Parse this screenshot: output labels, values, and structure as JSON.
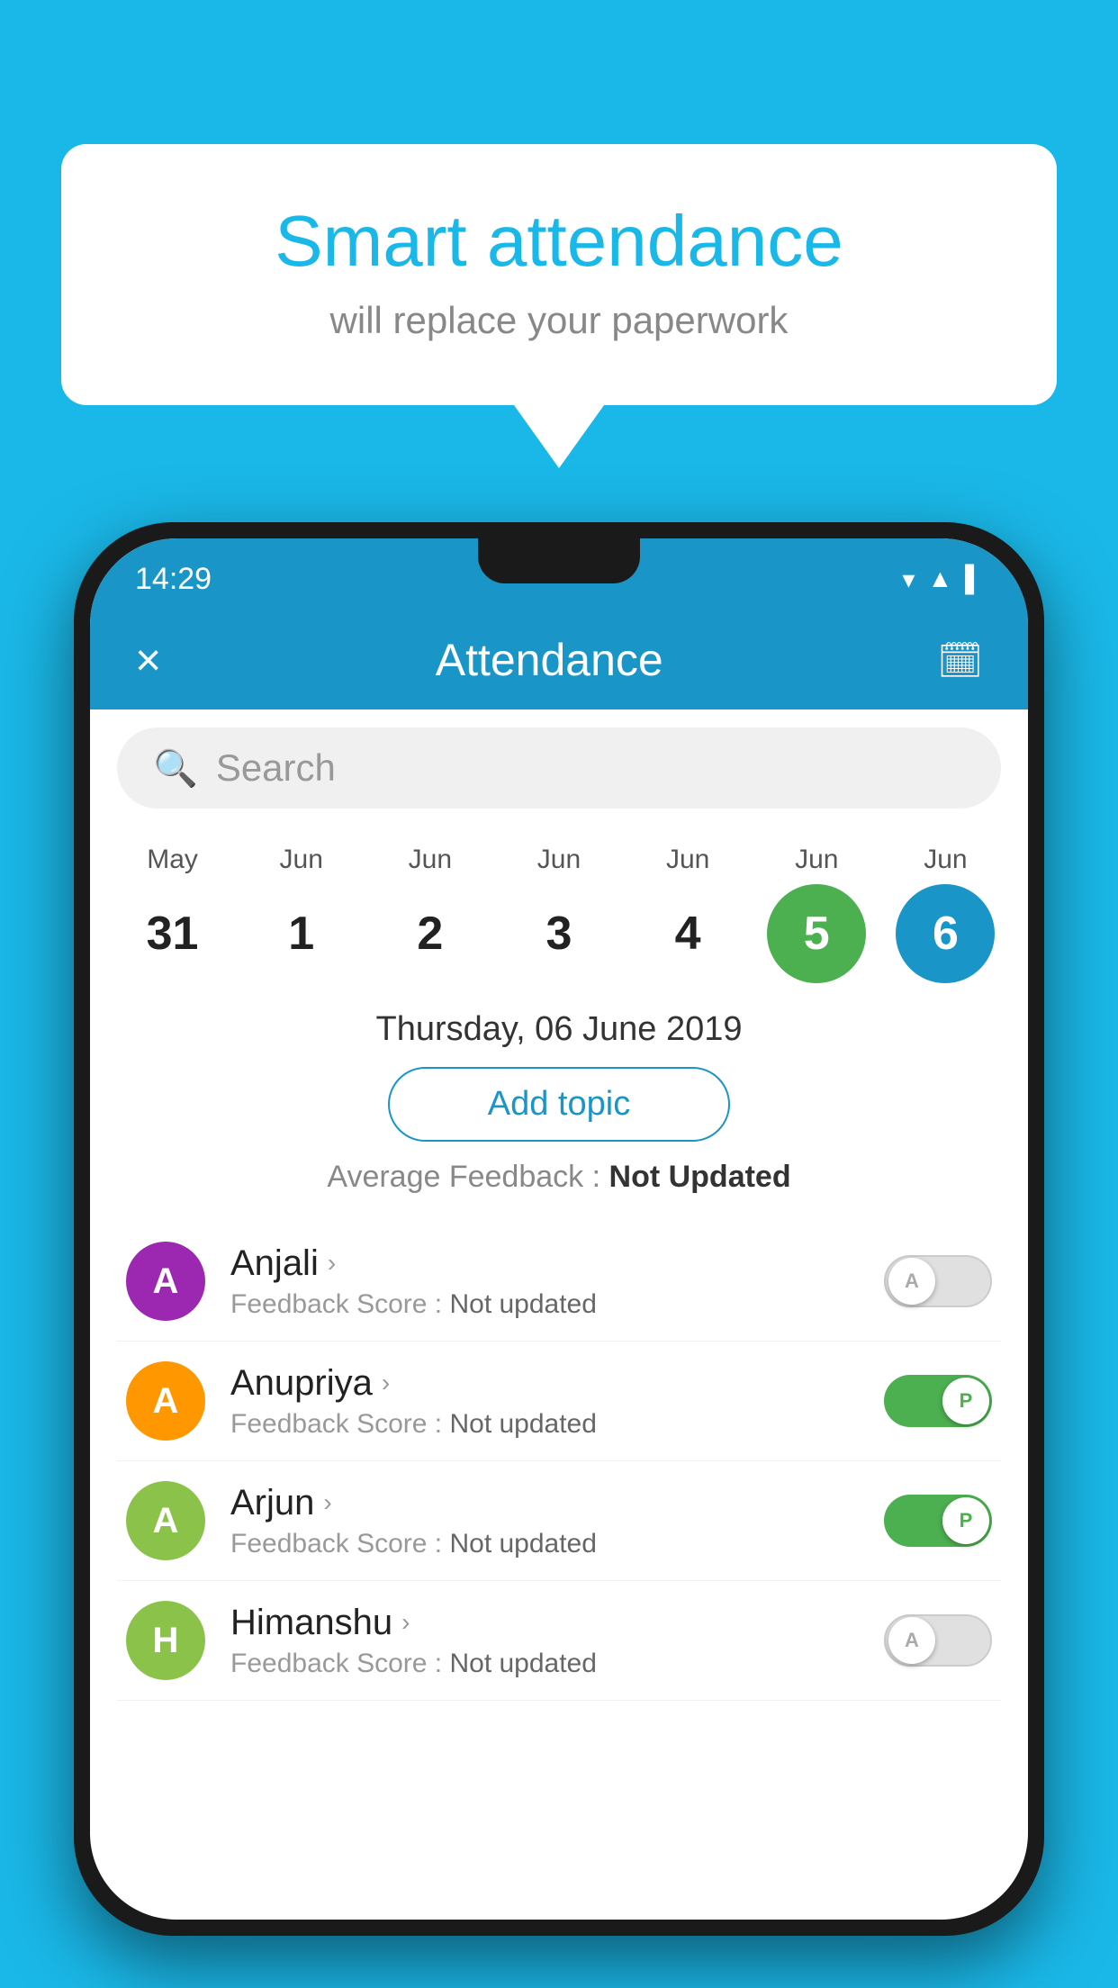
{
  "background_color": "#1ab8e8",
  "speech_bubble": {
    "title": "Smart attendance",
    "subtitle": "will replace your paperwork"
  },
  "status_bar": {
    "time": "14:29",
    "icons": [
      "wifi",
      "signal",
      "battery"
    ]
  },
  "app_header": {
    "title": "Attendance",
    "close_label": "×",
    "calendar_icon": "📅"
  },
  "search": {
    "placeholder": "Search"
  },
  "calendar": {
    "days": [
      {
        "month": "May",
        "date": "31",
        "state": "normal"
      },
      {
        "month": "Jun",
        "date": "1",
        "state": "normal"
      },
      {
        "month": "Jun",
        "date": "2",
        "state": "normal"
      },
      {
        "month": "Jun",
        "date": "3",
        "state": "normal"
      },
      {
        "month": "Jun",
        "date": "4",
        "state": "normal"
      },
      {
        "month": "Jun",
        "date": "5",
        "state": "today"
      },
      {
        "month": "Jun",
        "date": "6",
        "state": "selected"
      }
    ]
  },
  "selected_date": "Thursday, 06 June 2019",
  "add_topic_label": "Add topic",
  "avg_feedback_label": "Average Feedback :",
  "avg_feedback_value": "Not Updated",
  "students": [
    {
      "name": "Anjali",
      "avatar_letter": "A",
      "avatar_color": "purple",
      "feedback_label": "Feedback Score :",
      "feedback_value": "Not updated",
      "toggle_state": "off",
      "toggle_letter": "A"
    },
    {
      "name": "Anupriya",
      "avatar_letter": "A",
      "avatar_color": "orange",
      "feedback_label": "Feedback Score :",
      "feedback_value": "Not updated",
      "toggle_state": "on",
      "toggle_letter": "P"
    },
    {
      "name": "Arjun",
      "avatar_letter": "A",
      "avatar_color": "light-green",
      "feedback_label": "Feedback Score :",
      "feedback_value": "Not updated",
      "toggle_state": "on",
      "toggle_letter": "P"
    },
    {
      "name": "Himanshu",
      "avatar_letter": "H",
      "avatar_color": "light-green",
      "feedback_label": "Feedback Score :",
      "feedback_value": "Not updated",
      "toggle_state": "off",
      "toggle_letter": "A"
    }
  ]
}
